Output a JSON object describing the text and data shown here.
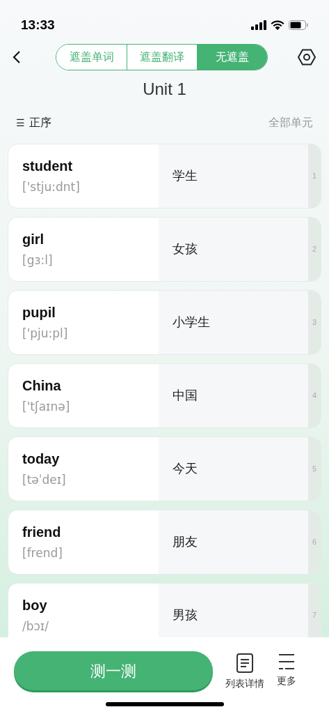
{
  "status_bar": {
    "time": "13:33"
  },
  "tabs": [
    {
      "label": "遮盖单词",
      "selected": false
    },
    {
      "label": "遮盖翻译",
      "selected": false
    },
    {
      "label": "无遮盖",
      "selected": true
    }
  ],
  "title": "Unit 1",
  "sort": {
    "icon_text": "☰",
    "label": "正序"
  },
  "all_units": "全部单元",
  "words": [
    {
      "word": "student",
      "phonetic": "['stju:dnt]",
      "translation": "学生",
      "index": "1"
    },
    {
      "word": "girl",
      "phonetic": "[gɜ:l]",
      "translation": "女孩",
      "index": "2"
    },
    {
      "word": "pupil",
      "phonetic": "['pju:pl]",
      "translation": "小学生",
      "index": "3"
    },
    {
      "word": "China",
      "phonetic": "['tʃaɪnə]",
      "translation": "中国",
      "index": "4"
    },
    {
      "word": "today",
      "phonetic": "[təˈdeɪ]",
      "translation": "今天",
      "index": "5"
    },
    {
      "word": "friend",
      "phonetic": "[frend]",
      "translation": "朋友",
      "index": "6"
    },
    {
      "word": "boy",
      "phonetic": "/bɔɪ/",
      "translation": "男孩",
      "index": "7"
    }
  ],
  "bottom_bar": {
    "test_button": "测一测",
    "actions": [
      {
        "kind": "list",
        "label": "列表详情"
      },
      {
        "kind": "more",
        "label": "更多"
      }
    ]
  }
}
